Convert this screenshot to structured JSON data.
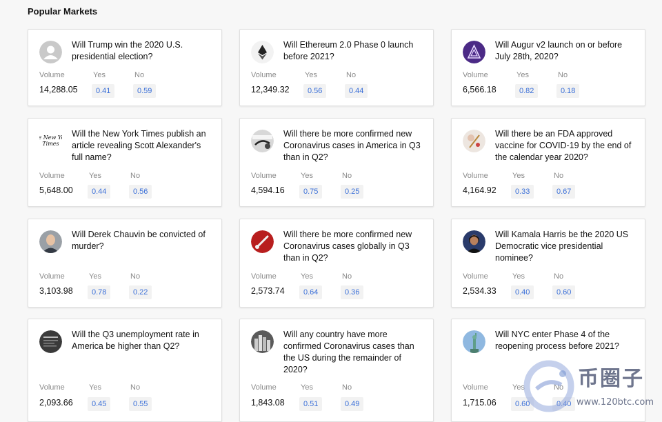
{
  "section": {
    "title": "Popular Markets"
  },
  "labels": {
    "volume": "Volume",
    "yes": "Yes",
    "no": "No"
  },
  "markets": [
    {
      "question": "Will Trump win the 2020 U.S. presidential election?",
      "volume": "14,288.05",
      "yes": "0.41",
      "no": "0.59",
      "icon": "default-user-avatar"
    },
    {
      "question": "Will Ethereum 2.0 Phase 0 launch before 2021?",
      "volume": "12,349.32",
      "yes": "0.56",
      "no": "0.44",
      "icon": "ethereum-logo"
    },
    {
      "question": "Will Augur v2 launch on or before July 28th, 2020?",
      "volume": "6,566.18",
      "yes": "0.82",
      "no": "0.18",
      "icon": "augur-logo"
    },
    {
      "question": "Will the New York Times publish an article revealing Scott Alexander's full name?",
      "volume": "5,648.00",
      "yes": "0.44",
      "no": "0.56",
      "icon": "nyt-logo"
    },
    {
      "question": "Will there be more confirmed new Coronavirus cases in America in Q3 than in Q2?",
      "volume": "4,594.16",
      "yes": "0.75",
      "no": "0.25",
      "icon": "stethoscope-photo"
    },
    {
      "question": "Will there be an FDA approved vaccine for COVID-19 by the end of the calendar year 2020?",
      "volume": "4,164.92",
      "yes": "0.33",
      "no": "0.67",
      "icon": "vaccine-photo"
    },
    {
      "question": "Will Derek Chauvin be convicted of murder?",
      "volume": "3,103.98",
      "yes": "0.78",
      "no": "0.22",
      "icon": "portrait-photo"
    },
    {
      "question": "Will there be more confirmed new Coronavirus cases globally in Q3 than in Q2?",
      "volume": "2,573.74",
      "yes": "0.64",
      "no": "0.36",
      "icon": "thermometer-photo"
    },
    {
      "question": "Will Kamala Harris be the 2020 US Democratic vice presidential nominee?",
      "volume": "2,534.33",
      "yes": "0.40",
      "no": "0.60",
      "icon": "portrait-photo"
    },
    {
      "question": "Will the Q3 unemployment rate in America be higher than Q2?",
      "volume": "2,093.66",
      "yes": "0.45",
      "no": "0.55",
      "icon": "newspaper-photo"
    },
    {
      "question": "Will any country have more confirmed Coronavirus cases than the US during the remainder of 2020?",
      "volume": "1,843.08",
      "yes": "0.51",
      "no": "0.49",
      "icon": "city-photo"
    },
    {
      "question": "Will NYC enter Phase 4 of the reopening process before 2021?",
      "volume": "1,715.06",
      "yes": "0.60",
      "no": "0.40",
      "icon": "statue-of-liberty-photo"
    }
  ],
  "watermark": {
    "text": "币圈子",
    "url": "www.120btc.com"
  }
}
